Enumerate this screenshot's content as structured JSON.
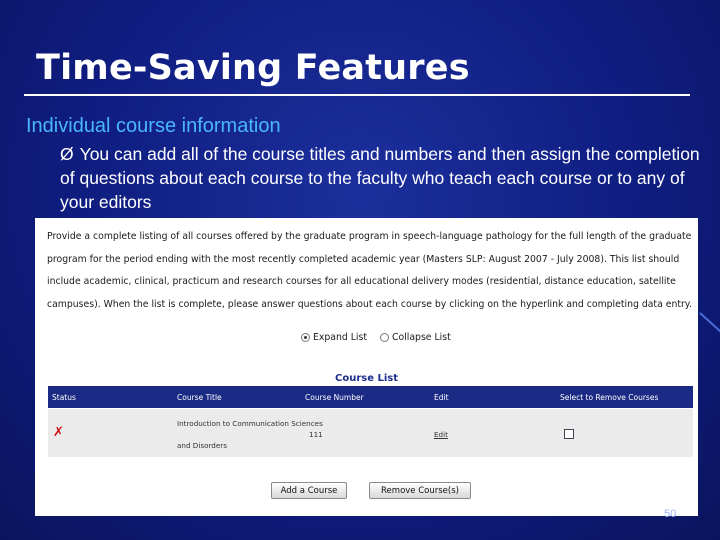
{
  "slide": {
    "title": "Time-Saving Features",
    "subtitle": "Individual course information",
    "bullet_arrow": "Ø",
    "bullet": "You can add all of the course titles and numbers and then assign the completion of questions about each course to the faculty who teach each course or to any of your editors",
    "page_number": "50"
  },
  "screenshot": {
    "intro": "Provide a complete listing of all courses offered by the graduate program in speech-language pathology for the full length of the graduate program for the period ending with the most recently completed academic year (Masters SLP: August 2007 - July 2008). This list should include academic, clinical, practicum and research courses for all educational delivery modes (residential, distance education, satellite campuses). When the list is complete, please answer questions about each course by clicking on the hyperlink and completing data entry.",
    "expand_label": "Expand List",
    "collapse_label": "Collapse List",
    "list_title": "Course List",
    "columns": [
      "Status",
      "Course Title",
      "Course Number",
      "Edit",
      "Select to Remove Courses"
    ],
    "rows": [
      {
        "status_icon": "x-icon",
        "title_line1": "Introduction to Communication Sciences",
        "title_line2": "and Disorders",
        "number": "111",
        "edit": "Edit"
      }
    ],
    "add_button": "Add a Course",
    "remove_button": "Remove Course(s)"
  }
}
